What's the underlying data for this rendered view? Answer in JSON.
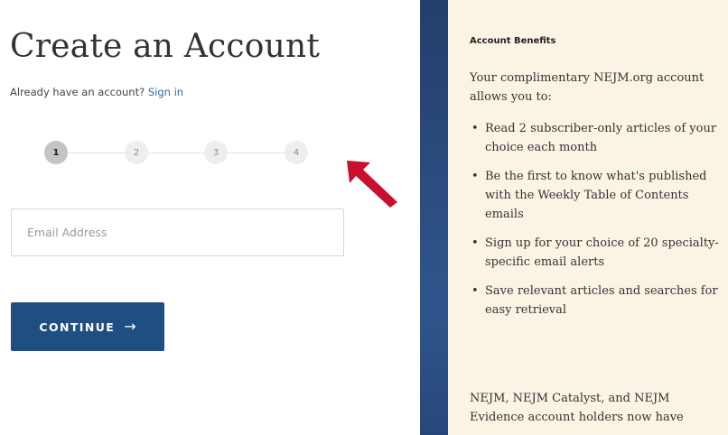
{
  "form": {
    "title": "Create an Account",
    "signin_prompt": "Already have an account?",
    "signin_link": "Sign in",
    "steps": [
      "1",
      "2",
      "3",
      "4"
    ],
    "active_step": 1,
    "email": {
      "placeholder": "Email Address",
      "value": ""
    },
    "continue_label": "CONTINUE",
    "continue_icon": "arrow-right-icon"
  },
  "annotation": {
    "icon": "red-arrow-icon",
    "color": "#c8102e"
  },
  "benefits": {
    "heading": "Account Benefits",
    "intro": "Your complimentary NEJM.org account allows you to:",
    "items": [
      "Read 2 subscriber-only articles of your choice each month",
      "Be the first to know what's published with the Weekly Table of Contents emails",
      "Sign up for your choice of 20 specialty-specific email alerts",
      "Save relevant articles and searches for easy retrieval"
    ],
    "footer": "NEJM, NEJM Catalyst, and NEJM Evidence account holders now have"
  },
  "colors": {
    "button": "#1f4e83",
    "link": "#2d6aa3",
    "panel_bg": "#fbf4e5",
    "panel_band": "#2b4d80"
  }
}
